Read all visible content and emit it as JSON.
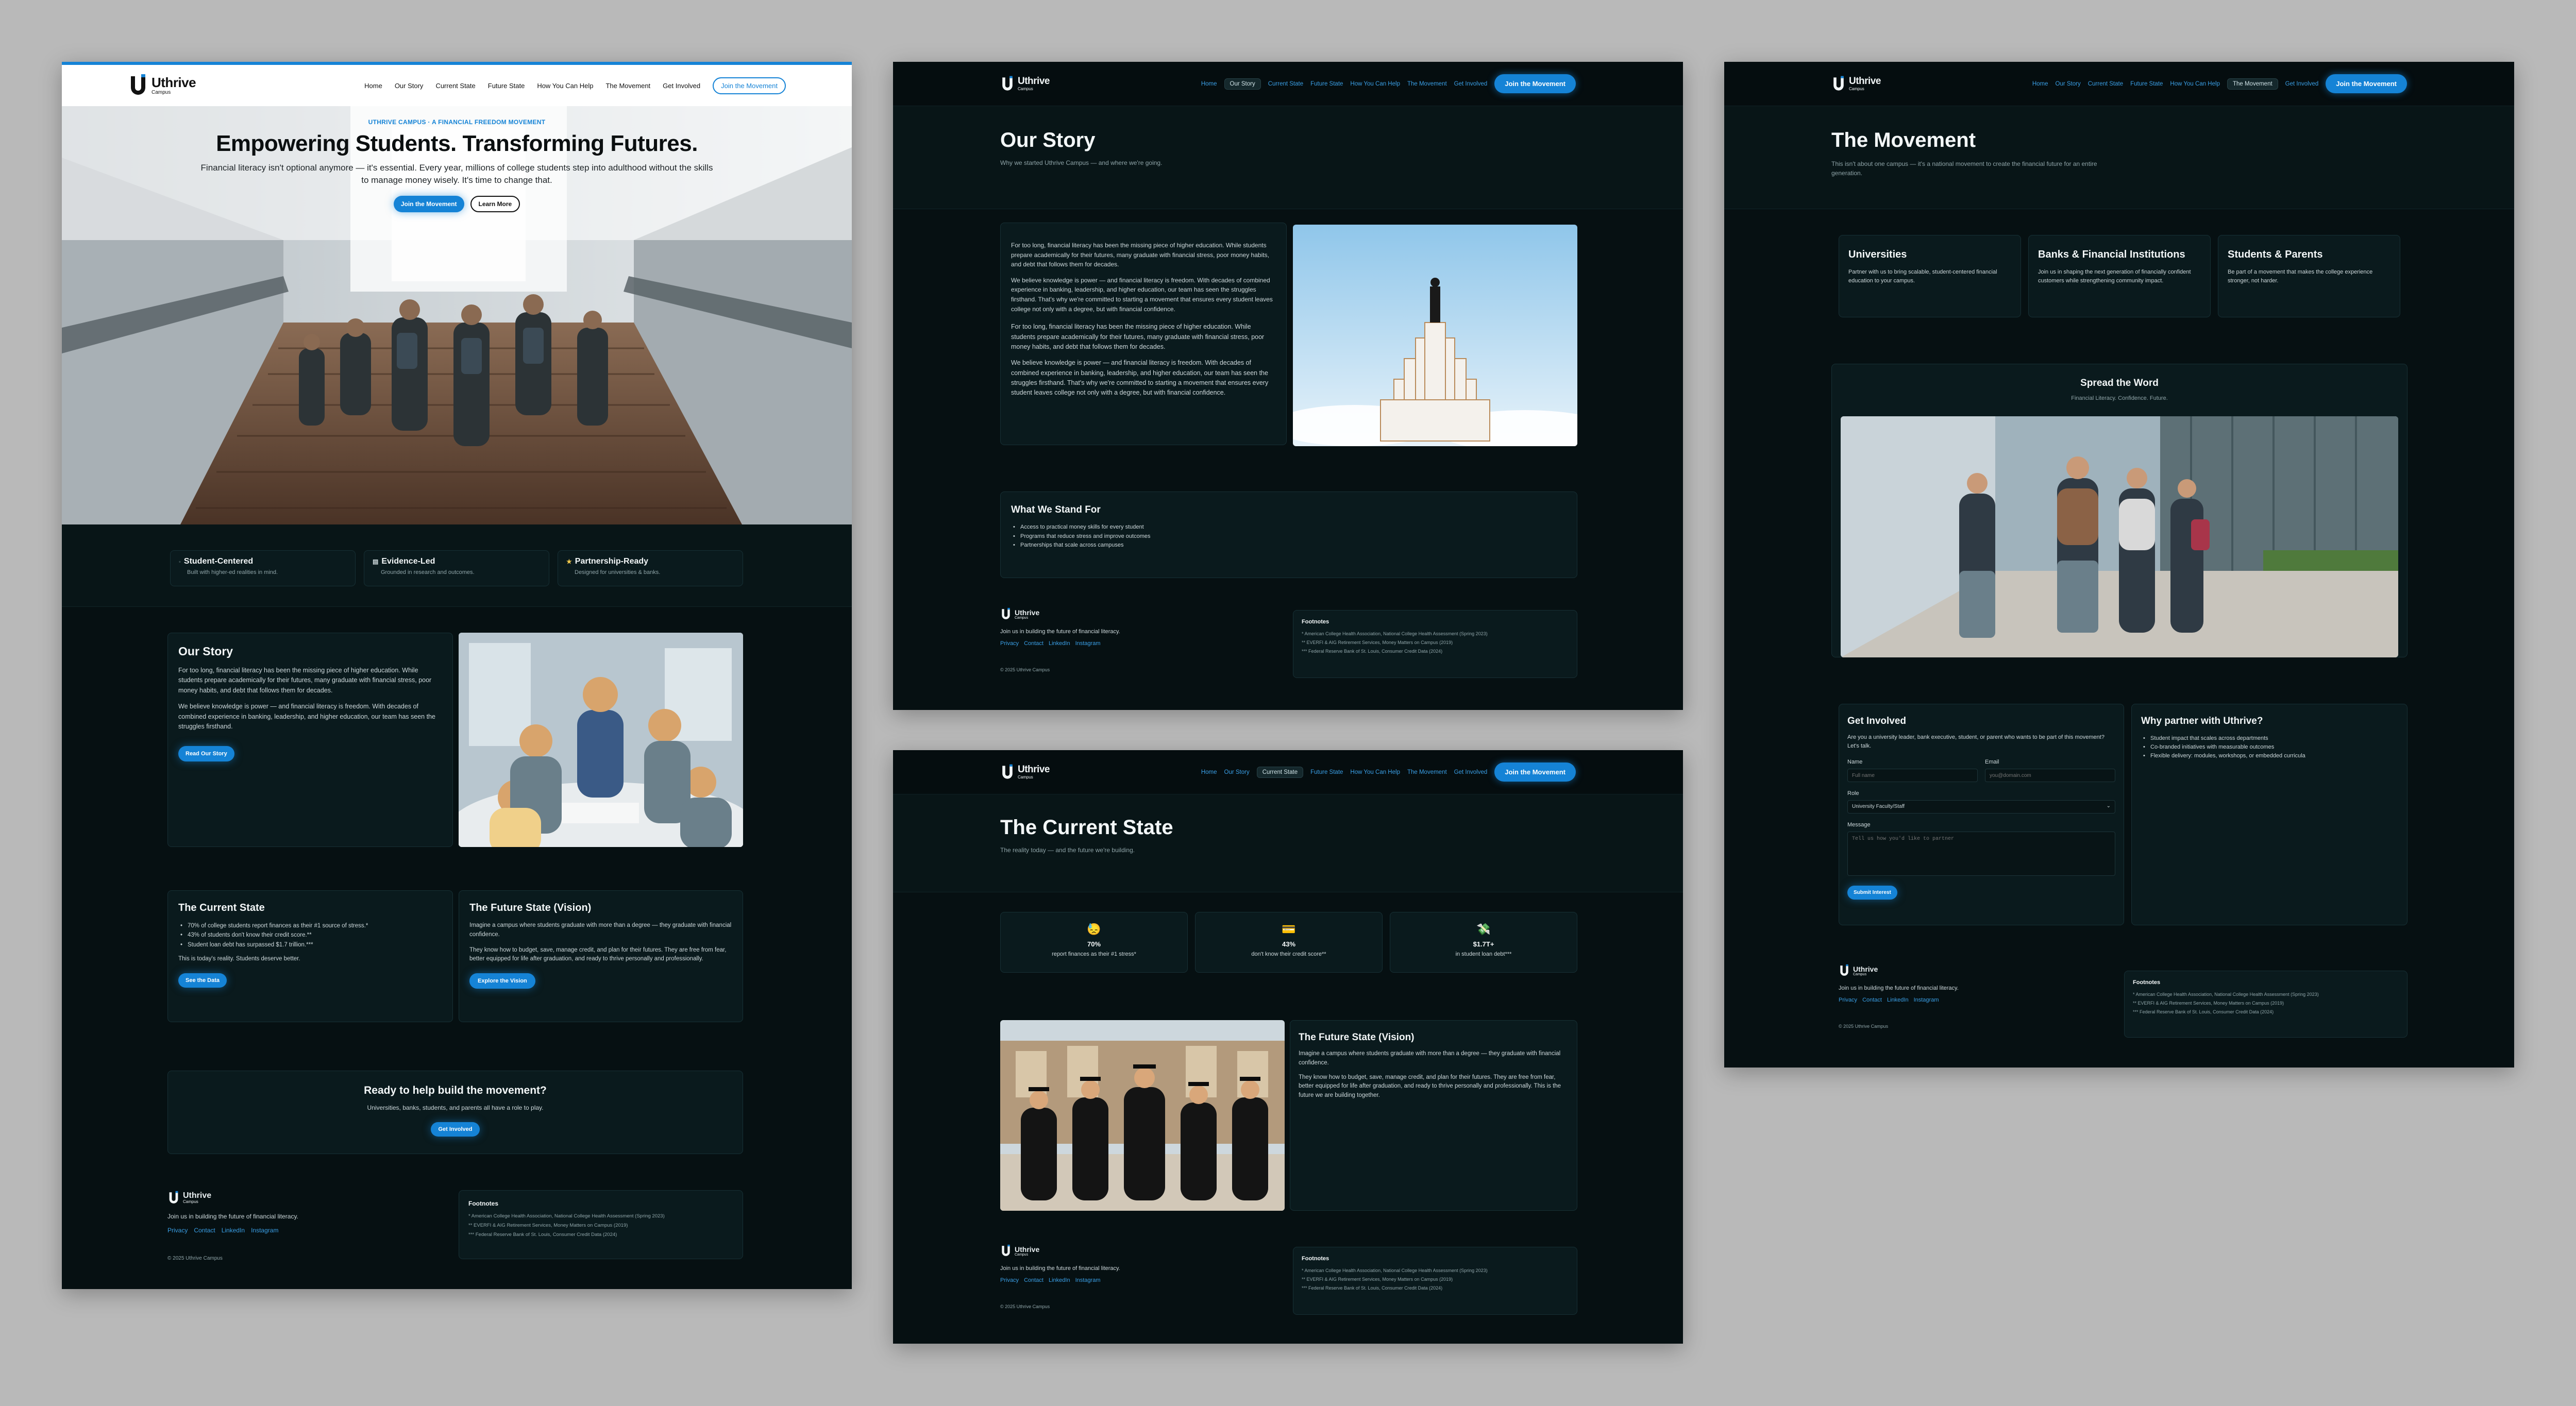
{
  "brand": {
    "name": "Uthrive",
    "sub": "Campus"
  },
  "nav_home": {
    "links": [
      "Home",
      "Our Story",
      "Current State",
      "Future State",
      "How You Can Help",
      "The Movement",
      "Get Involved"
    ],
    "cta": "Join the Movement"
  },
  "nav_dark": {
    "links": [
      "Home",
      "Our Story",
      "Current State",
      "Future State",
      "How You Can Help",
      "The Movement",
      "Get Involved"
    ],
    "cta": "Join the Movement"
  },
  "home": {
    "eyebrow": "UTHRIVE CAMPUS · A FINANCIAL FREEDOM MOVEMENT",
    "title": "Empowering Students. Transforming Futures.",
    "subtitle": "Financial literacy isn't optional anymore — it's essential. Every year, millions of college students step into adulthood without the skills to manage money wisely. It's time to change that.",
    "cta_primary": "Join the Movement",
    "cta_secondary": "Learn More",
    "features": [
      {
        "title": "Student-Centered",
        "desc": "Built with higher-ed realities in mind."
      },
      {
        "title": "Evidence-Led",
        "desc": "Grounded in research and outcomes."
      },
      {
        "title": "Partnership-Ready",
        "desc": "Designed for universities & banks."
      }
    ],
    "story": {
      "title": "Our Story",
      "p1": "For too long, financial literacy has been the missing piece of higher education. While students prepare academically for their futures, many graduate with financial stress, poor money habits, and debt that follows them for decades.",
      "p2": "We believe knowledge is power — and financial literacy is freedom. With decades of combined experience in banking, leadership, and higher education, our team has seen the struggles firsthand.",
      "button": "Read Our Story"
    },
    "current": {
      "title": "The Current State",
      "bullets": [
        "70% of college students report finances as their #1 source of stress.*",
        "43% of students don't know their credit score.**",
        "Student loan debt has surpassed $1.7 trillion.***"
      ],
      "note": "This is today's reality. Students deserve better.",
      "button": "See the Data"
    },
    "future": {
      "title": "The Future State (Vision)",
      "p1": "Imagine a campus where students graduate with more than a degree — they graduate with financial confidence.",
      "p2": "They know how to budget, save, manage credit, and plan for their futures. They are free from fear, better equipped for life after graduation, and ready to thrive personally and professionally.",
      "button": "Explore the Vision"
    },
    "cta_band": {
      "title": "Ready to help build the movement?",
      "sub": "Universities, banks, students, and parents all have a role to play.",
      "button": "Get Involved"
    }
  },
  "footer": {
    "tagline": "Join us in building the future of financial literacy.",
    "links": [
      "Privacy",
      "Contact",
      "LinkedIn",
      "Instagram"
    ],
    "copyright": "© 2025 Uthrive Campus",
    "footnotes_title": "Footnotes",
    "footnotes": [
      "* American College Health Association, National College Health Assessment (Spring 2023)",
      "** EVERFI & AIG Retirement Services, Money Matters on Campus (2019)",
      "*** Federal Reserve Bank of St. Louis, Consumer Credit Data (2024)"
    ]
  },
  "our_story": {
    "title": "Our Story",
    "sub": "Why we started Uthrive Campus — and where we're going.",
    "p1": "For too long, financial literacy has been the missing piece of higher education. While students prepare academically for their futures, many graduate with financial stress, poor money habits, and debt that follows them for decades.",
    "p2": "We believe knowledge is power — and financial literacy is freedom. With decades of combined experience in banking, leadership, and higher education, our team has seen the struggles firsthand. That's why we're committed to starting a movement that ensures every student leaves college not only with a degree, but with financial confidence.",
    "p3": "For too long, financial literacy has been the missing piece of higher education. While students prepare academically for their futures, many graduate with financial stress, poor money habits, and debt that follows them for decades.",
    "p4": "We believe knowledge is power — and financial literacy is freedom. With decades of combined experience in banking, leadership, and higher education, our team has seen the struggles firsthand. That's why we're committed to starting a movement that ensures every student leaves college not only with a degree, but with financial confidence.",
    "stand_title": "What We Stand For",
    "stand": [
      "Access to practical money skills for every student",
      "Programs that reduce stress and improve outcomes",
      "Partnerships that scale across campuses"
    ]
  },
  "current_state": {
    "title": "The Current State",
    "sub": "The reality today — and the future we're building.",
    "stats": [
      {
        "icon": "😓",
        "value": "70%",
        "label": "report finances as their #1 stress*"
      },
      {
        "icon": "💳",
        "value": "43%",
        "label": "don't know their credit score**"
      },
      {
        "icon": "💸",
        "value": "$1.7T+",
        "label": "in student loan debt***"
      }
    ],
    "future_title": "The Future State (Vision)",
    "future_p1": "Imagine a campus where students graduate with more than a degree — they graduate with financial confidence.",
    "future_p2": "They know how to budget, save, manage credit, and plan for their futures. They are free from fear, better equipped for life after graduation, and ready to thrive personally and professionally. This is the future we are building together."
  },
  "movement": {
    "title": "The Movement",
    "sub": "This isn't about one campus — it's a national movement to create the financial future for an entire generation.",
    "audiences": [
      {
        "title": "Universities",
        "desc": "Partner with us to bring scalable, student-centered financial education to your campus."
      },
      {
        "title": "Banks & Financial Institutions",
        "desc": "Join us in shaping the next generation of financially confident customers while strengthening community impact."
      },
      {
        "title": "Students & Parents",
        "desc": "Be part of a movement that makes the college experience stronger, not harder."
      }
    ],
    "spread_title": "Spread the Word",
    "spread_sub": "Financial Literacy. Confidence. Future.",
    "involved_title": "Get Involved",
    "involved_sub": "Are you a university leader, bank executive, student, or parent who wants to be part of this movement? Let's talk.",
    "form": {
      "name_label": "Name",
      "name_placeholder": "Full name",
      "email_label": "Email",
      "email_placeholder": "you@domain.com",
      "role_label": "Role",
      "role_value": "University Faculty/Staff",
      "message_label": "Message",
      "message_placeholder": "Tell us how you'd like to partner",
      "submit": "Submit Interest"
    },
    "why_title": "Why partner with Uthrive?",
    "why": [
      "Student impact that scales across departments",
      "Co-branded initiatives with measurable outcomes",
      "Flexible delivery: modules, workshops, or embedded curricula"
    ]
  },
  "colors": {
    "accent": "#1583d6",
    "bg": "#061012",
    "panel": "#0a1a1d"
  }
}
